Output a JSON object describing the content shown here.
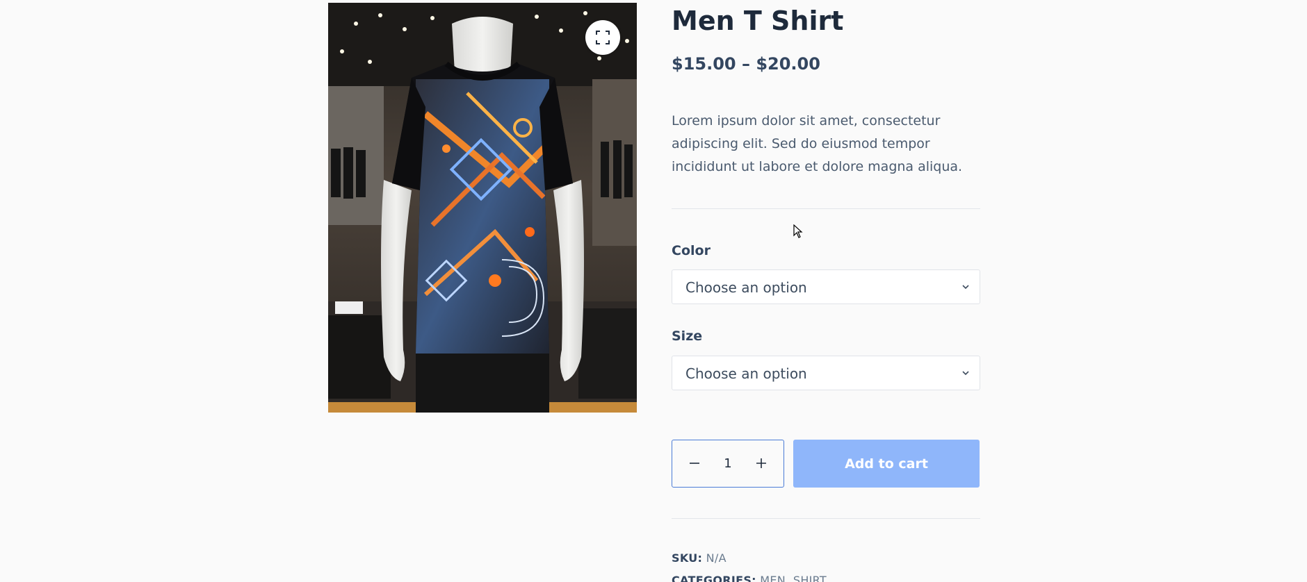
{
  "product": {
    "title": "Men T Shirt",
    "price": "$15.00 – $20.00",
    "description": "Lorem ipsum dolor sit amet, consectetur adipiscing elit. Sed do eiusmod tempor incididunt ut labore et dolore magna aliqua.",
    "image_alt": "Men T Shirt"
  },
  "variations": {
    "color": {
      "label": "Color",
      "selected": "Choose an option"
    },
    "size": {
      "label": "Size",
      "selected": "Choose an option"
    }
  },
  "cart": {
    "quantity": "1",
    "add_to_cart_label": "Add to cart"
  },
  "meta": {
    "sku_label": "SKU:",
    "sku_value": "N/A",
    "categories_label": "CATEGORIES:",
    "categories": [
      "MEN",
      "SHIRT"
    ],
    "separator": ", "
  },
  "icons": {
    "zoom": "fullscreen-icon",
    "dropdown": "chevron-down-icon",
    "minus": "minus-icon",
    "plus": "plus-icon",
    "cursor": "mouse-cursor-icon"
  },
  "colors": {
    "heading": "#1e2a3b",
    "price": "#334660",
    "body_text": "#4a5a6e",
    "button_disabled": "#8fb6fa",
    "quantity_border": "#4a7bd6",
    "divider": "#e3e6ea"
  }
}
